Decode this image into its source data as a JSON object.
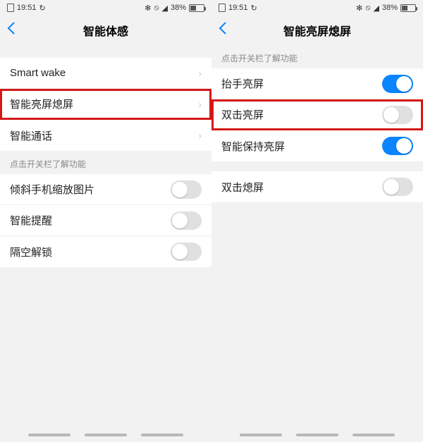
{
  "left": {
    "status": {
      "time": "19:51",
      "battery": "38%",
      "bt": "✻",
      "dnd": "🔕"
    },
    "title": "智能体感",
    "nav_items": [
      {
        "label": "Smart wake",
        "highlighted": false
      },
      {
        "label": "智能亮屏熄屏",
        "highlighted": true
      },
      {
        "label": "智能通话",
        "highlighted": false
      }
    ],
    "section_label": "点击开关栏了解功能",
    "toggle_items": [
      {
        "label": "倾斜手机缩放图片",
        "on": false
      },
      {
        "label": "智能提醒",
        "on": false
      },
      {
        "label": "隔空解锁",
        "on": false
      }
    ]
  },
  "right": {
    "status": {
      "time": "19:51",
      "battery": "38%",
      "bt": "✻",
      "dnd": "🔕"
    },
    "title": "智能亮屏熄屏",
    "section_label": "点击开关栏了解功能",
    "toggle_group1": [
      {
        "label": "抬手亮屏",
        "on": true,
        "highlighted": false
      },
      {
        "label": "双击亮屏",
        "on": false,
        "highlighted": true
      },
      {
        "label": "智能保持亮屏",
        "on": true,
        "highlighted": false
      }
    ],
    "toggle_group2": [
      {
        "label": "双击熄屏",
        "on": false
      }
    ]
  }
}
